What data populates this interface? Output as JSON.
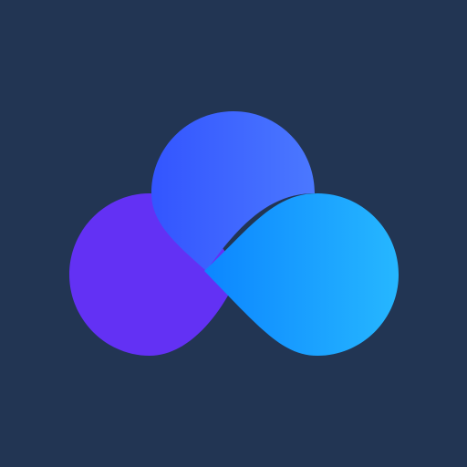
{
  "app_icon": {
    "icon": "cloud-logo-icon",
    "colors": {
      "background": "#223553",
      "left_lobe": "#6331F4",
      "top_lobe_start": "#3355FF",
      "top_lobe_end": "#4B78FF",
      "right_lobe_start": "#0C86FF",
      "right_lobe_end": "#26B7FF"
    }
  }
}
